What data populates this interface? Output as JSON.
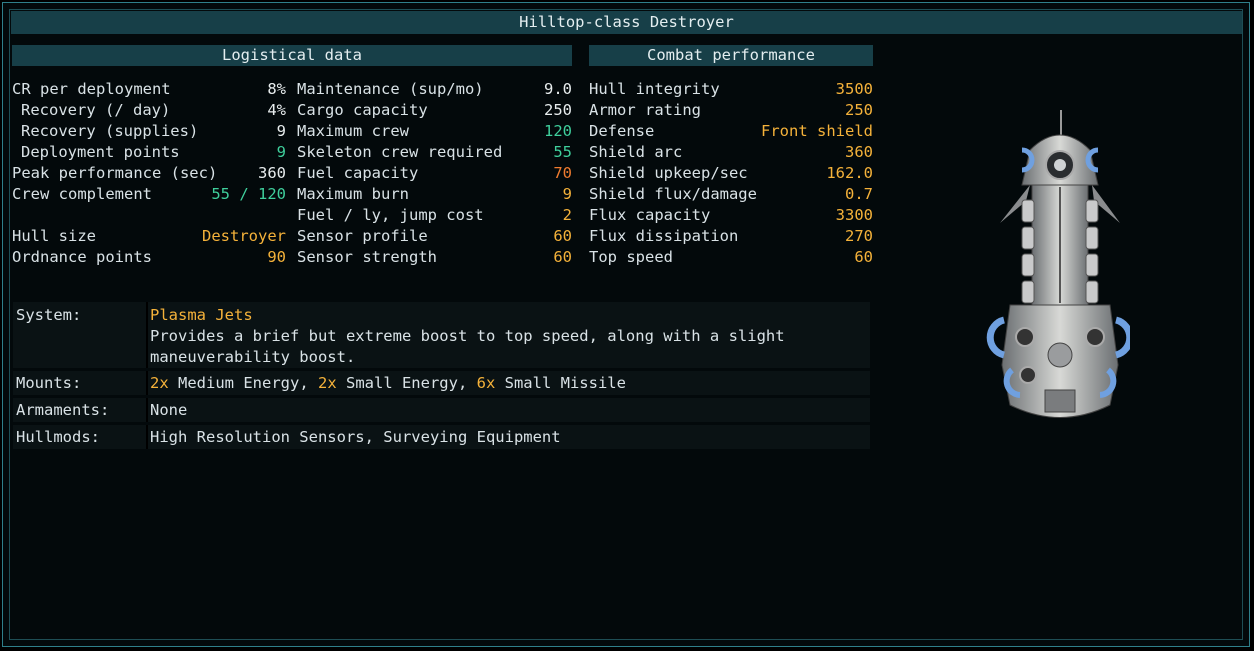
{
  "title": "Hilltop-class Destroyer",
  "colors": {
    "gold": "#f5b23a",
    "cyan": "#3fcf9c",
    "orange": "#ef7b2f",
    "header_bg": "#173f48"
  },
  "logistics": {
    "header": "Logistical data",
    "left": [
      {
        "label": "CR per deployment",
        "value": "8%"
      },
      {
        "label": " Recovery (/ day)",
        "value": "4%"
      },
      {
        "label": " Recovery (supplies)",
        "value": "9"
      },
      {
        "label": " Deployment points",
        "value": "9"
      },
      {
        "label": "Peak performance (sec)",
        "value": "360"
      },
      {
        "label": "Crew complement",
        "value": "55 / 120"
      },
      {
        "label": "Hull size",
        "value": "Destroyer"
      },
      {
        "label": "Ordnance points",
        "value": "90"
      }
    ],
    "right": [
      {
        "label": "Maintenance (sup/mo)",
        "value": "9.0"
      },
      {
        "label": "Cargo capacity",
        "value": "250"
      },
      {
        "label": "Maximum crew",
        "value": "120"
      },
      {
        "label": "Skeleton crew required",
        "value": "55"
      },
      {
        "label": "Fuel capacity",
        "value": "70"
      },
      {
        "label": "Maximum burn",
        "value": "9"
      },
      {
        "label": "Fuel / ly, jump cost",
        "value": "2"
      },
      {
        "label": "Sensor profile",
        "value": "60"
      },
      {
        "label": "Sensor strength",
        "value": "60"
      }
    ]
  },
  "combat": {
    "header": "Combat performance",
    "rows": [
      {
        "label": "Hull integrity",
        "value": "3500"
      },
      {
        "label": "Armor rating",
        "value": "250"
      },
      {
        "label": "Defense",
        "value": "Front shield"
      },
      {
        "label": "Shield arc",
        "value": "360"
      },
      {
        "label": "Shield upkeep/sec",
        "value": "162.0"
      },
      {
        "label": "Shield flux/damage",
        "value": "0.7"
      },
      {
        "label": "Flux capacity",
        "value": "3300"
      },
      {
        "label": "Flux dissipation",
        "value": "270"
      },
      {
        "label": "Top speed",
        "value": "60"
      }
    ]
  },
  "system": {
    "label": "System:",
    "name": "Plasma Jets",
    "desc1": "Provides a brief but extreme boost to top speed, along with a slight",
    "desc2": "maneuverability boost."
  },
  "mounts": {
    "label": "Mounts:",
    "m1n": "2x",
    "m1t": " Medium Energy, ",
    "m2n": "2x",
    "m2t": " Small Energy, ",
    "m3n": "6x",
    "m3t": " Small Missile"
  },
  "armaments": {
    "label": "Armaments:",
    "value": "None"
  },
  "hullmods": {
    "label": "Hullmods:",
    "value": "High Resolution Sensors, Surveying Equipment"
  }
}
